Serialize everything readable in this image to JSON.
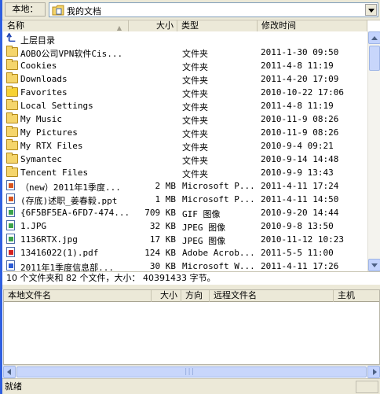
{
  "address": {
    "label": "本地：",
    "path": "我的文档"
  },
  "columns": {
    "name": "名称",
    "size": "大小",
    "type": "类型",
    "modified": "修改时间"
  },
  "up_row": {
    "name": "上层目录"
  },
  "files": [
    {
      "name": "AOBO公司VPN软件Cis...",
      "size": "",
      "type": "文件夹",
      "time": "2011-1-30 09:50",
      "icon": "folder-icon"
    },
    {
      "name": "Cookies",
      "size": "",
      "type": "文件夹",
      "time": "2011-4-8 11:19",
      "icon": "folder-icon"
    },
    {
      "name": "Downloads",
      "size": "",
      "type": "文件夹",
      "time": "2011-4-20 17:09",
      "icon": "folder-icon"
    },
    {
      "name": "Favorites",
      "size": "",
      "type": "文件夹",
      "time": "2010-10-22 17:06",
      "icon": "star-folder-icon"
    },
    {
      "name": "Local Settings",
      "size": "",
      "type": "文件夹",
      "time": "2011-4-8 11:19",
      "icon": "folder-icon"
    },
    {
      "name": "My Music",
      "size": "",
      "type": "文件夹",
      "time": "2010-11-9 08:26",
      "icon": "music-folder-icon"
    },
    {
      "name": "My Pictures",
      "size": "",
      "type": "文件夹",
      "time": "2010-11-9 08:26",
      "icon": "pictures-folder-icon"
    },
    {
      "name": "My RTX Files",
      "size": "",
      "type": "文件夹",
      "time": "2010-9-4 09:21",
      "icon": "folder-icon"
    },
    {
      "name": "Symantec",
      "size": "",
      "type": "文件夹",
      "time": "2010-9-14 14:48",
      "icon": "folder-icon"
    },
    {
      "name": "Tencent Files",
      "size": "",
      "type": "文件夹",
      "time": "2010-9-9 13:43",
      "icon": "folder-icon"
    },
    {
      "name": "（new）2011年1季度...",
      "size": "2 MB",
      "type": "Microsoft P...",
      "time": "2011-4-11 17:24",
      "icon": "powerpoint-file-icon"
    },
    {
      "name": "(存底)述职_姜春毅.ppt",
      "size": "1 MB",
      "type": "Microsoft P...",
      "time": "2011-4-11 14:50",
      "icon": "powerpoint-file-icon"
    },
    {
      "name": "{6F5BF5EA-6FD7-474...",
      "size": "709 KB",
      "type": "GIF 图像",
      "time": "2010-9-20 14:44",
      "icon": "image-file-icon"
    },
    {
      "name": "1.JPG",
      "size": "32 KB",
      "type": "JPEG 图像",
      "time": "2010-9-8 13:50",
      "icon": "image-file-icon"
    },
    {
      "name": "1136RTX.jpg",
      "size": "17 KB",
      "type": "JPEG 图像",
      "time": "2010-11-12 10:23",
      "icon": "image-file-icon"
    },
    {
      "name": "13416022(1).pdf",
      "size": "124 KB",
      "type": "Adobe Acrob...",
      "time": "2011-5-5 11:00",
      "icon": "pdf-file-icon"
    },
    {
      "name": "2011年1季度信息部...",
      "size": "30 KB",
      "type": "Microsoft W...",
      "time": "2011-4-11 17:26",
      "icon": "word-file-icon"
    }
  ],
  "local_status": "10 个文件夹和 82 个文件，大小： 40391433 字节。",
  "queue_columns": {
    "local_name": "本地文件名",
    "size": "大小",
    "direction": "方向",
    "remote_name": "远程文件名",
    "host": "主机"
  },
  "statusbar": {
    "text": "就绪"
  }
}
